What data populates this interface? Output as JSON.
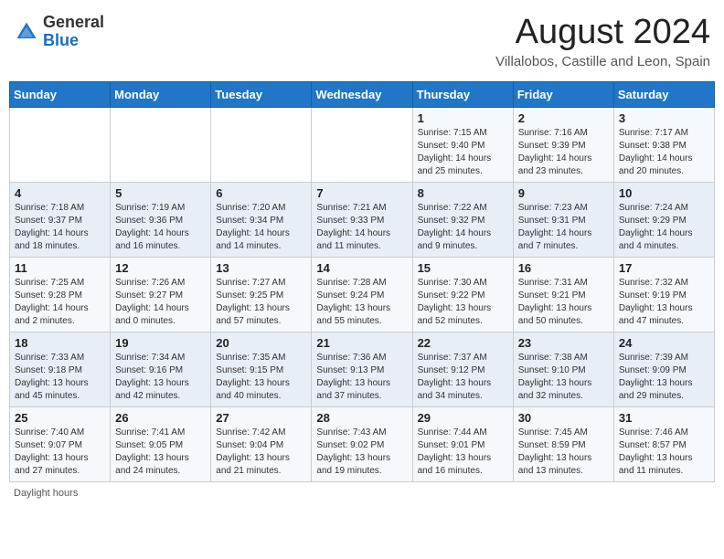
{
  "header": {
    "logo_general": "General",
    "logo_blue": "Blue",
    "month_title": "August 2024",
    "subtitle": "Villalobos, Castille and Leon, Spain"
  },
  "weekdays": [
    "Sunday",
    "Monday",
    "Tuesday",
    "Wednesday",
    "Thursday",
    "Friday",
    "Saturday"
  ],
  "weeks": [
    [
      {
        "day": "",
        "info": ""
      },
      {
        "day": "",
        "info": ""
      },
      {
        "day": "",
        "info": ""
      },
      {
        "day": "",
        "info": ""
      },
      {
        "day": "1",
        "info": "Sunrise: 7:15 AM\nSunset: 9:40 PM\nDaylight: 14 hours and 25 minutes."
      },
      {
        "day": "2",
        "info": "Sunrise: 7:16 AM\nSunset: 9:39 PM\nDaylight: 14 hours and 23 minutes."
      },
      {
        "day": "3",
        "info": "Sunrise: 7:17 AM\nSunset: 9:38 PM\nDaylight: 14 hours and 20 minutes."
      }
    ],
    [
      {
        "day": "4",
        "info": "Sunrise: 7:18 AM\nSunset: 9:37 PM\nDaylight: 14 hours and 18 minutes."
      },
      {
        "day": "5",
        "info": "Sunrise: 7:19 AM\nSunset: 9:36 PM\nDaylight: 14 hours and 16 minutes."
      },
      {
        "day": "6",
        "info": "Sunrise: 7:20 AM\nSunset: 9:34 PM\nDaylight: 14 hours and 14 minutes."
      },
      {
        "day": "7",
        "info": "Sunrise: 7:21 AM\nSunset: 9:33 PM\nDaylight: 14 hours and 11 minutes."
      },
      {
        "day": "8",
        "info": "Sunrise: 7:22 AM\nSunset: 9:32 PM\nDaylight: 14 hours and 9 minutes."
      },
      {
        "day": "9",
        "info": "Sunrise: 7:23 AM\nSunset: 9:31 PM\nDaylight: 14 hours and 7 minutes."
      },
      {
        "day": "10",
        "info": "Sunrise: 7:24 AM\nSunset: 9:29 PM\nDaylight: 14 hours and 4 minutes."
      }
    ],
    [
      {
        "day": "11",
        "info": "Sunrise: 7:25 AM\nSunset: 9:28 PM\nDaylight: 14 hours and 2 minutes."
      },
      {
        "day": "12",
        "info": "Sunrise: 7:26 AM\nSunset: 9:27 PM\nDaylight: 14 hours and 0 minutes."
      },
      {
        "day": "13",
        "info": "Sunrise: 7:27 AM\nSunset: 9:25 PM\nDaylight: 13 hours and 57 minutes."
      },
      {
        "day": "14",
        "info": "Sunrise: 7:28 AM\nSunset: 9:24 PM\nDaylight: 13 hours and 55 minutes."
      },
      {
        "day": "15",
        "info": "Sunrise: 7:30 AM\nSunset: 9:22 PM\nDaylight: 13 hours and 52 minutes."
      },
      {
        "day": "16",
        "info": "Sunrise: 7:31 AM\nSunset: 9:21 PM\nDaylight: 13 hours and 50 minutes."
      },
      {
        "day": "17",
        "info": "Sunrise: 7:32 AM\nSunset: 9:19 PM\nDaylight: 13 hours and 47 minutes."
      }
    ],
    [
      {
        "day": "18",
        "info": "Sunrise: 7:33 AM\nSunset: 9:18 PM\nDaylight: 13 hours and 45 minutes."
      },
      {
        "day": "19",
        "info": "Sunrise: 7:34 AM\nSunset: 9:16 PM\nDaylight: 13 hours and 42 minutes."
      },
      {
        "day": "20",
        "info": "Sunrise: 7:35 AM\nSunset: 9:15 PM\nDaylight: 13 hours and 40 minutes."
      },
      {
        "day": "21",
        "info": "Sunrise: 7:36 AM\nSunset: 9:13 PM\nDaylight: 13 hours and 37 minutes."
      },
      {
        "day": "22",
        "info": "Sunrise: 7:37 AM\nSunset: 9:12 PM\nDaylight: 13 hours and 34 minutes."
      },
      {
        "day": "23",
        "info": "Sunrise: 7:38 AM\nSunset: 9:10 PM\nDaylight: 13 hours and 32 minutes."
      },
      {
        "day": "24",
        "info": "Sunrise: 7:39 AM\nSunset: 9:09 PM\nDaylight: 13 hours and 29 minutes."
      }
    ],
    [
      {
        "day": "25",
        "info": "Sunrise: 7:40 AM\nSunset: 9:07 PM\nDaylight: 13 hours and 27 minutes."
      },
      {
        "day": "26",
        "info": "Sunrise: 7:41 AM\nSunset: 9:05 PM\nDaylight: 13 hours and 24 minutes."
      },
      {
        "day": "27",
        "info": "Sunrise: 7:42 AM\nSunset: 9:04 PM\nDaylight: 13 hours and 21 minutes."
      },
      {
        "day": "28",
        "info": "Sunrise: 7:43 AM\nSunset: 9:02 PM\nDaylight: 13 hours and 19 minutes."
      },
      {
        "day": "29",
        "info": "Sunrise: 7:44 AM\nSunset: 9:01 PM\nDaylight: 13 hours and 16 minutes."
      },
      {
        "day": "30",
        "info": "Sunrise: 7:45 AM\nSunset: 8:59 PM\nDaylight: 13 hours and 13 minutes."
      },
      {
        "day": "31",
        "info": "Sunrise: 7:46 AM\nSunset: 8:57 PM\nDaylight: 13 hours and 11 minutes."
      }
    ]
  ],
  "footer": "Daylight hours"
}
